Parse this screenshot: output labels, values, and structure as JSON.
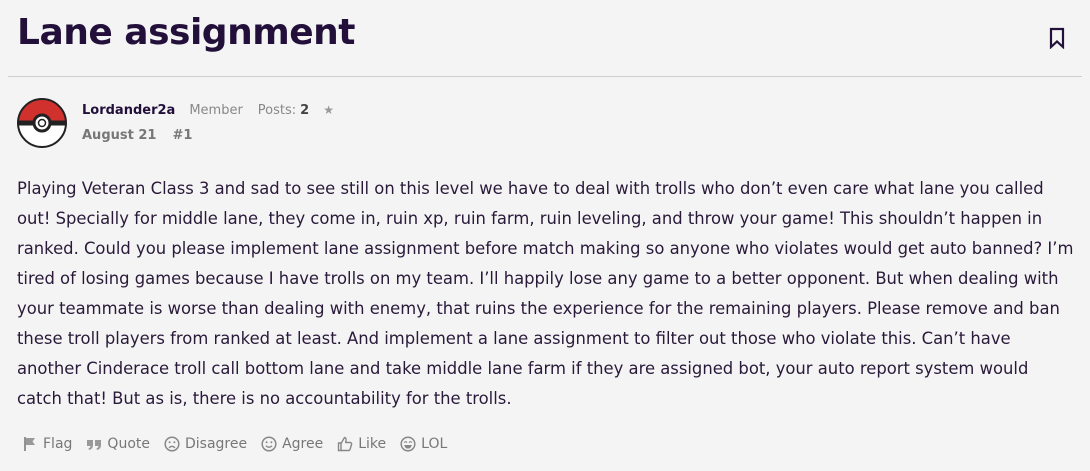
{
  "page": {
    "title": "Lane assignment"
  },
  "post": {
    "author": "Lordander2a",
    "role": "Member",
    "posts_label": "Posts:",
    "posts_count": "2",
    "date": "August 21",
    "post_number": "#1",
    "body": "Playing Veteran Class 3 and sad to see still on this level we have to deal with trolls who don’t even care what lane you called out! Specially for middle lane, they come in, ruin xp, ruin farm, ruin leveling, and throw your game! This shouldn’t happen in ranked. Could you please implement lane assignment before match making so anyone who violates would get auto banned? I’m tired of losing games because I have trolls on my team. I’ll happily lose any game to a better opponent. But when dealing with your teammate is worse than dealing with enemy, that ruins the experience for the remaining players. Please remove and ban these troll players from ranked at least. And implement a lane assignment to filter out those who violate this. Can’t have another Cinderace troll call bottom lane and take middle lane farm if they are assigned bot, your auto report system would catch that! But as is, there is no accountability for the trolls."
  },
  "reactions": [
    {
      "label": "Flag",
      "icon": "flag-icon"
    },
    {
      "label": "Quote",
      "icon": "quote-icon"
    },
    {
      "label": "Disagree",
      "icon": "frown-icon"
    },
    {
      "label": "Agree",
      "icon": "smile-icon"
    },
    {
      "label": "Like",
      "icon": "thumbs-up-icon"
    },
    {
      "label": "LOL",
      "icon": "laugh-icon"
    }
  ],
  "colors": {
    "title": "#22103a",
    "text": "#2a1a3a",
    "muted": "#777777",
    "avatar_red": "#d0312d"
  }
}
